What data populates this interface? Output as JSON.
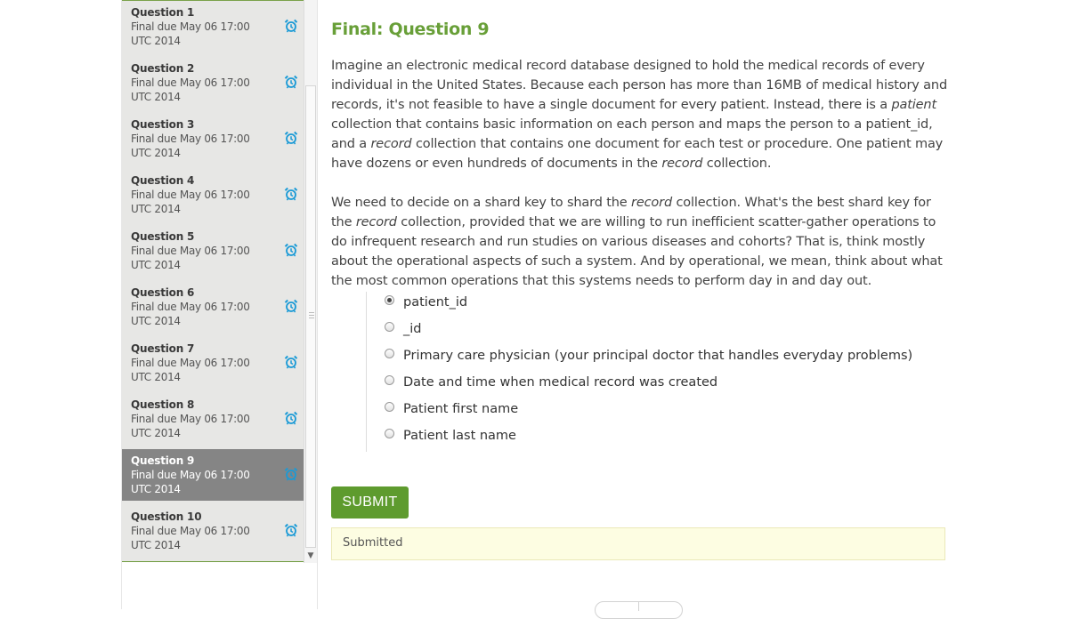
{
  "sidebar": {
    "items": [
      {
        "title": "Question 1",
        "due_line1": "Final due May 06 17:00",
        "due_line2": "UTC 2014",
        "icon": "alarm-clock-icon"
      },
      {
        "title": "Question 2",
        "due_line1": "Final due May 06 17:00",
        "due_line2": "UTC 2014",
        "icon": "alarm-clock-icon"
      },
      {
        "title": "Question 3",
        "due_line1": "Final due May 06 17:00",
        "due_line2": "UTC 2014",
        "icon": "alarm-clock-icon"
      },
      {
        "title": "Question 4",
        "due_line1": "Final due May 06 17:00",
        "due_line2": "UTC 2014",
        "icon": "alarm-clock-icon"
      },
      {
        "title": "Question 5",
        "due_line1": "Final due May 06 17:00",
        "due_line2": "UTC 2014",
        "icon": "alarm-clock-icon"
      },
      {
        "title": "Question 6",
        "due_line1": "Final due May 06 17:00",
        "due_line2": "UTC 2014",
        "icon": "alarm-clock-icon"
      },
      {
        "title": "Question 7",
        "due_line1": "Final due May 06 17:00",
        "due_line2": "UTC 2014",
        "icon": "alarm-clock-icon"
      },
      {
        "title": "Question 8",
        "due_line1": "Final due May 06 17:00",
        "due_line2": "UTC 2014",
        "icon": "alarm-clock-icon"
      },
      {
        "title": "Question 9",
        "due_line1": "Final due May 06 17:00",
        "due_line2": "UTC 2014",
        "icon": "alarm-clock-icon",
        "active": true
      },
      {
        "title": "Question 10",
        "due_line1": "Final due May 06 17:00",
        "due_line2": "UTC 2014",
        "icon": "alarm-clock-icon"
      }
    ]
  },
  "problem": {
    "title": "Final: Question 9",
    "paragraph1": {
      "a": "Imagine an electronic medical record database designed to hold the medical records of every individual in the United States. Because each person has more than 16MB of medical history and records, it's not feasible to have a single document for every patient. Instead, there is a ",
      "b": "patient",
      "c": " collection that contains basic information on each person and maps the person to a patient_id, and a ",
      "d": "record",
      "e": " collection that contains one document for each test or procedure. One patient may have dozens or even hundreds of documents in the ",
      "f": "record",
      "g": " collection."
    },
    "paragraph2": {
      "a": "We need to decide on a shard key to shard the ",
      "b": "record",
      "c": " collection. What's the best shard key for the ",
      "d": "record",
      "e": " collection, provided that we are willing to run inefficient scatter-gather operations to do infrequent research and run studies on various diseases and cohorts? That is, think mostly about the operational aspects of such a system. And by operational, we mean, think about what the most common operations that this systems needs to perform day in and day out."
    },
    "choices": [
      {
        "label": "patient_id",
        "checked": true
      },
      {
        "label": "_id",
        "checked": false
      },
      {
        "label": "Primary care physician (your principal doctor that handles everyday problems)",
        "checked": false
      },
      {
        "label": "Date and time when medical record was created",
        "checked": false
      },
      {
        "label": "Patient first name",
        "checked": false
      },
      {
        "label": "Patient last name",
        "checked": false
      }
    ],
    "submit_label": "SUBMIT",
    "status_text": "Submitted"
  },
  "colors": {
    "accent_green": "#689f38",
    "button_green": "#5e9b2e",
    "icon_blue": "#1a9ad6",
    "active_item_bg": "#858585",
    "status_bg": "#fdfde2"
  }
}
